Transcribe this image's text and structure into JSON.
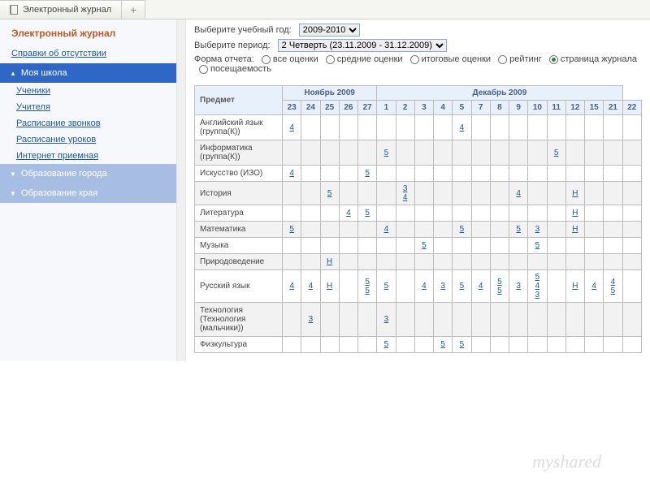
{
  "tab": {
    "title": "Электронный журнал",
    "add": "+"
  },
  "sidebar": {
    "heading": "Электронный журнал",
    "link_absence": "Справки об отсутствии",
    "group_school": "Моя школа",
    "subs": [
      "Ученики",
      "Учителя",
      "Расписание звонков",
      "Расписание уроков",
      "Интернет приемная"
    ],
    "group_city": "Образование города",
    "group_region": "Образование края"
  },
  "filters": {
    "year_label": "Выберите учебный год:",
    "year_value": "2009-2010",
    "period_label": "Выберите период:",
    "period_value": "2 Четверть (23.11.2009 - 31.12.2009)",
    "form_label": "Форма отчета:",
    "opts": [
      "все оценки",
      "средние оценки",
      "итоговые оценки",
      "рейтинг",
      "страница журнала",
      "посещаемость"
    ]
  },
  "table": {
    "subject_header": "Предмет",
    "months": [
      "Ноябрь 2009",
      "Декабрь 2009"
    ],
    "month_spans": [
      5,
      13
    ],
    "days": [
      "23",
      "24",
      "25",
      "26",
      "27",
      "1",
      "2",
      "3",
      "4",
      "5",
      "7",
      "8",
      "9",
      "10",
      "11",
      "12",
      "15",
      "21",
      "22"
    ],
    "rows": [
      {
        "name": "Английский язык (группа(К))",
        "cells": [
          "4",
          "",
          "",
          "",
          "",
          "",
          "",
          "",
          "",
          "4",
          "",
          "",
          "",
          "",
          "",
          "",
          "",
          "",
          ""
        ]
      },
      {
        "name": "Информатика (группа(К))",
        "cells": [
          "",
          "",
          "",
          "",
          "",
          "5",
          "",
          "",
          "",
          "",
          "",
          "",
          "",
          "",
          "5",
          "",
          "",
          "",
          ""
        ]
      },
      {
        "name": "Искусство (ИЗО)",
        "cells": [
          "4",
          "",
          "",
          "",
          "5",
          "",
          "",
          "",
          "",
          "",
          "",
          "",
          "",
          "",
          "",
          "",
          "",
          "",
          ""
        ]
      },
      {
        "name": "История",
        "cells": [
          "",
          "",
          "5",
          "",
          "",
          "",
          "3\n4",
          "",
          "",
          "",
          "",
          "",
          "4",
          "",
          "",
          "Н",
          "",
          "",
          ""
        ]
      },
      {
        "name": "Литература",
        "cells": [
          "",
          "",
          "",
          "4",
          "5",
          "",
          "",
          "",
          "",
          "",
          "",
          "",
          "",
          "",
          "",
          "Н",
          "",
          "",
          ""
        ]
      },
      {
        "name": "Математика",
        "cells": [
          "5",
          "",
          "",
          "",
          "",
          "4",
          "",
          "",
          "",
          "5",
          "",
          "",
          "5",
          "3",
          "",
          "Н",
          "",
          "",
          ""
        ]
      },
      {
        "name": "Музыка",
        "cells": [
          "",
          "",
          "",
          "",
          "",
          "",
          "",
          "5",
          "",
          "",
          "",
          "",
          "",
          "5",
          "",
          "",
          "",
          "",
          ""
        ]
      },
      {
        "name": "Природоведение",
        "cells": [
          "",
          "",
          "Н",
          "",
          "",
          "",
          "",
          "",
          "",
          "",
          "",
          "",
          "",
          "",
          "",
          "",
          "",
          "",
          ""
        ]
      },
      {
        "name": "Русский язык",
        "cells": [
          "4",
          "4",
          "Н",
          "",
          "5\n5",
          "5",
          "",
          "4",
          "3",
          "5",
          "4",
          "5\n5",
          "3",
          "5\n4\n3",
          "",
          "Н",
          "4",
          "4\n5",
          ""
        ]
      },
      {
        "name": "Технология (Технология (мальчики))",
        "cells": [
          "",
          "3",
          "",
          "",
          "",
          "3",
          "",
          "",
          "",
          "",
          "",
          "",
          "",
          "",
          "",
          "",
          "",
          "",
          ""
        ]
      },
      {
        "name": "Физкультура",
        "cells": [
          "",
          "",
          "",
          "",
          "",
          "5",
          "",
          "",
          "5",
          "5",
          "",
          "",
          "",
          "",
          "",
          "",
          "",
          "",
          ""
        ]
      }
    ]
  },
  "watermark": "myshared"
}
